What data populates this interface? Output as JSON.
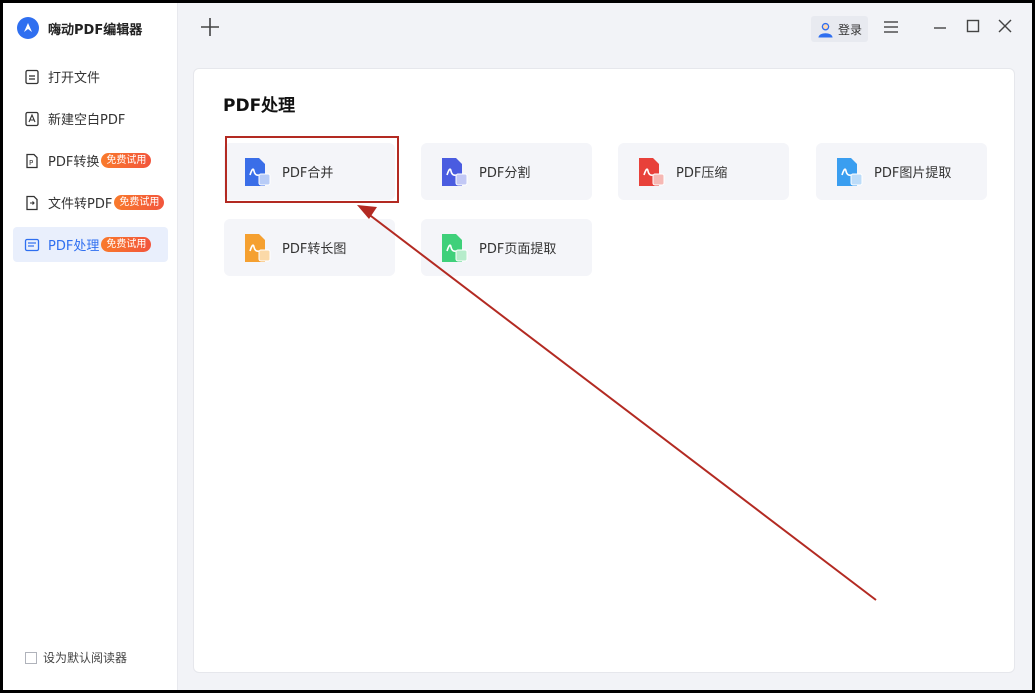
{
  "app": {
    "name": "嗨动PDF编辑器"
  },
  "sidebar": {
    "items": [
      {
        "label": "打开文件",
        "badge": "",
        "icon": "open-file-icon"
      },
      {
        "label": "新建空白PDF",
        "badge": "",
        "icon": "new-pdf-icon"
      },
      {
        "label": "PDF转换",
        "badge": "免费试用",
        "icon": "pdf-convert-icon"
      },
      {
        "label": "文件转PDF",
        "badge": "免费试用",
        "icon": "file-to-pdf-icon"
      },
      {
        "label": "PDF处理",
        "badge": "免费试用",
        "icon": "pdf-process-icon",
        "active": true
      }
    ],
    "default_reader_label": "设为默认阅读器"
  },
  "topbar": {
    "login_label": "登录"
  },
  "main": {
    "title": "PDF处理",
    "tools": [
      {
        "label": "PDF合并",
        "color": "#3a6ee8",
        "icon": "pdf-merge-icon"
      },
      {
        "label": "PDF分割",
        "color": "#4a5ce0",
        "icon": "pdf-split-icon"
      },
      {
        "label": "PDF压缩",
        "color": "#e8413a",
        "icon": "pdf-compress-icon"
      },
      {
        "label": "PDF图片提取",
        "color": "#3a9ef0",
        "icon": "pdf-image-extract-icon"
      },
      {
        "label": "PDF转长图",
        "color": "#f5a030",
        "icon": "pdf-to-long-image-icon"
      },
      {
        "label": "PDF页面提取",
        "color": "#3fd07a",
        "icon": "pdf-page-extract-icon"
      }
    ]
  },
  "colors": {
    "accent": "#2f6ff0",
    "annotation": "#b32a22"
  }
}
